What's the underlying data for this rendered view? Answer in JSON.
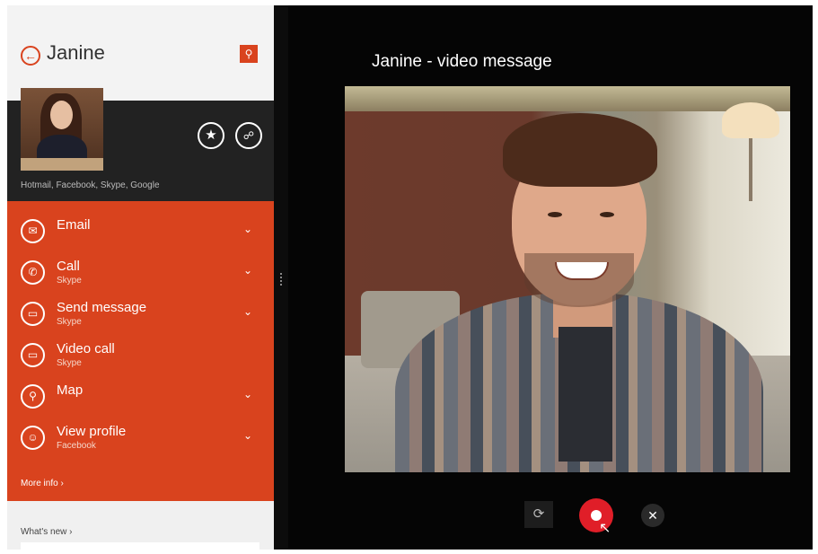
{
  "header": {
    "back_icon": "←",
    "contact_name": "Janine",
    "search_icon": "⚲"
  },
  "profile": {
    "star_icon": "★",
    "link_icon": "☍",
    "accounts": "Hotmail, Facebook, Skype, Google"
  },
  "actions": {
    "items": [
      {
        "label": "Email",
        "sub": "",
        "icon": "✉",
        "chevron": "⌄"
      },
      {
        "label": "Call",
        "sub": "Skype",
        "icon": "✆",
        "chevron": "⌄"
      },
      {
        "label": "Send message",
        "sub": "Skype",
        "icon": "▭",
        "chevron": "⌄"
      },
      {
        "label": "Video call",
        "sub": "Skype",
        "icon": "▭",
        "chevron": ""
      },
      {
        "label": "Map",
        "sub": "",
        "icon": "⚲",
        "chevron": "⌄"
      },
      {
        "label": "View profile",
        "sub": "Facebook",
        "icon": "☺",
        "chevron": "⌄"
      }
    ],
    "more_info": "More info ›"
  },
  "footer": {
    "whats_new": "What's new ›"
  },
  "video": {
    "title": "Janine  - video message"
  },
  "controls": {
    "switch_camera_icon": "⟳",
    "close_icon": "✕",
    "cursor_icon": "↖"
  },
  "colors": {
    "accent": "#d9431e",
    "record": "#e01e28",
    "dark_band": "#222222"
  }
}
